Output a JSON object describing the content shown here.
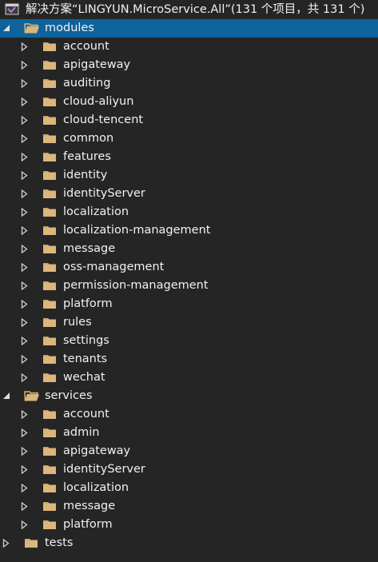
{
  "solution": {
    "title": "解决方案“LINGYUN.MicroService.All”(131 个项目，共 131 个)",
    "icon": "visual-studio-solution-icon"
  },
  "colors": {
    "background": "#252526",
    "selection": "#0e639c",
    "folder": "#dcb67a",
    "text": "#f1f1f1"
  },
  "folders": {
    "modules": {
      "label": "modules",
      "expanded": true,
      "selected": true,
      "items": [
        "account",
        "apigateway",
        "auditing",
        "cloud-aliyun",
        "cloud-tencent",
        "common",
        "features",
        "identity",
        "identityServer",
        "localization",
        "localization-management",
        "message",
        "oss-management",
        "permission-management",
        "platform",
        "rules",
        "settings",
        "tenants",
        "wechat"
      ]
    },
    "services": {
      "label": "services",
      "expanded": true,
      "items": [
        "account",
        "admin",
        "apigateway",
        "identityServer",
        "localization",
        "message",
        "platform"
      ]
    },
    "tests": {
      "label": "tests",
      "expanded": false
    }
  }
}
